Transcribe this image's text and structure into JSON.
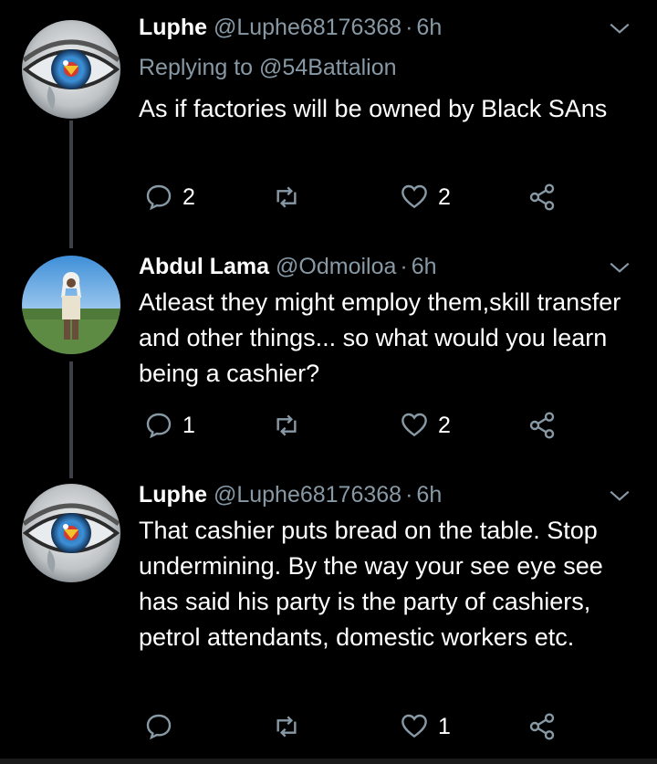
{
  "colors": {
    "background": "#000000",
    "text_primary": "#ffffff",
    "text_secondary": "#8899a6",
    "thread_line": "#3d4147"
  },
  "tweets": [
    {
      "name": "Luphe",
      "handle": "@Luphe68176368",
      "dot": "·",
      "time": "6h",
      "replying_label": "Replying to",
      "replying_to": "@54Battalion",
      "text": "As if factories will be owned by Black SAns",
      "reply_count": "2",
      "retweet_count": "",
      "like_count": "2",
      "avatar_icon": "eye-avatar"
    },
    {
      "name": "Abdul Lama",
      "handle": "@Odmoiloa",
      "dot": "·",
      "time": "6h",
      "text": "Atleast they might employ them,skill transfer and other things... so what would you learn being a cashier?",
      "reply_count": "1",
      "retweet_count": "",
      "like_count": "2",
      "avatar_icon": "person-in-field-avatar"
    },
    {
      "name": "Luphe",
      "handle": "@Luphe68176368",
      "dot": "·",
      "time": "6h",
      "text": "That cashier puts bread on the table. Stop undermining. By the way your see eye see has said his party is the party of cashiers, petrol attendants, domestic workers etc.",
      "reply_count": "",
      "retweet_count": "",
      "like_count": "1",
      "avatar_icon": "eye-avatar"
    }
  ]
}
